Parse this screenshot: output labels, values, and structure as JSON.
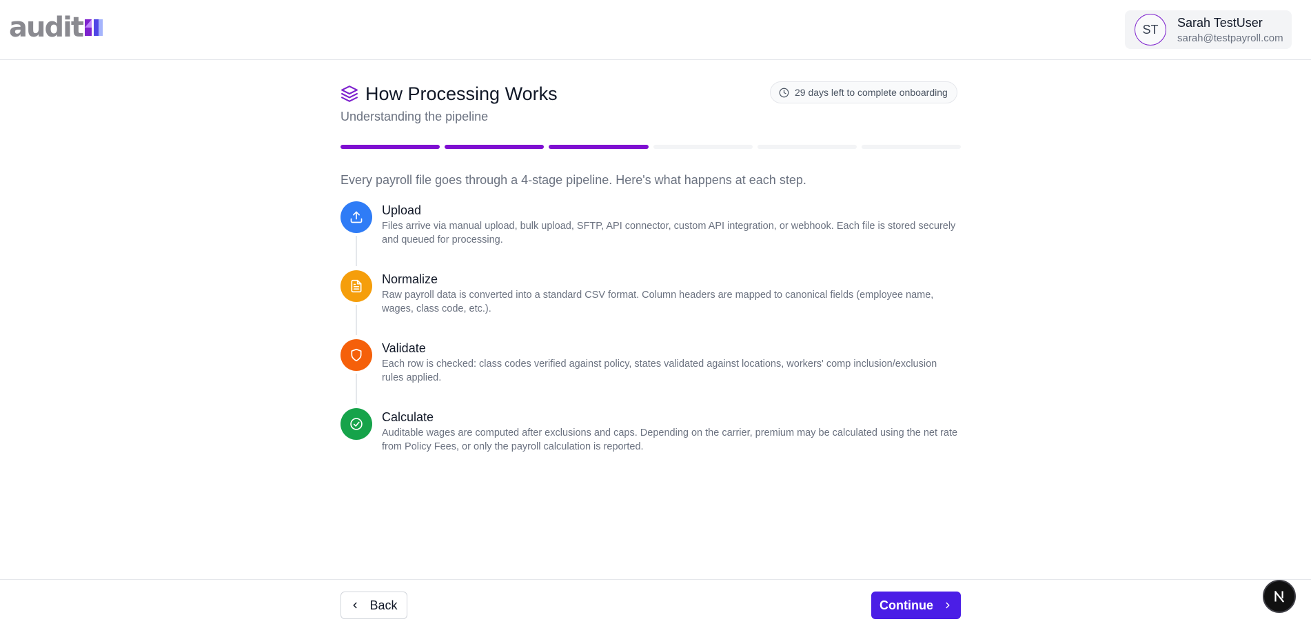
{
  "header": {
    "logo_text": "audit",
    "user": {
      "initials": "ST",
      "name": "Sarah TestUser",
      "email": "sarah@testpayroll.com"
    }
  },
  "page": {
    "title": "How Processing Works",
    "subtitle": "Understanding the pipeline",
    "days_left_text": "29 days left to complete onboarding",
    "progress": {
      "completed_steps": 3,
      "total_steps": 6
    },
    "intro": "Every payroll file goes through a 4-stage pipeline. Here's what happens at each step.",
    "steps": [
      {
        "title": "Upload",
        "icon": "upload-icon",
        "color": "#2f7cf6",
        "description": "Files arrive via manual upload, bulk upload, SFTP, API connector, custom API integration, or webhook. Each file is stored securely and queued for processing."
      },
      {
        "title": "Normalize",
        "icon": "file-text-icon",
        "color": "#f59e0b",
        "description": "Raw payroll data is converted into a standard CSV format. Column headers are mapped to canonical fields (employee name, wages, class code, etc.)."
      },
      {
        "title": "Validate",
        "icon": "shield-icon",
        "color": "#f5600a",
        "description": "Each row is checked: class codes verified against policy, states validated against locations, workers' comp inclusion/exclusion rules applied."
      },
      {
        "title": "Calculate",
        "icon": "check-circle-icon",
        "color": "#16a34a",
        "description": "Auditable wages are computed after exclusions and caps. Depending on the carrier, premium may be calculated using the net rate from Policy Fees, or only the payroll calculation is reported."
      }
    ]
  },
  "footer": {
    "back_label": "Back",
    "continue_label": "Continue"
  },
  "colors": {
    "accent_purple": "#7e0fd1",
    "continue_button": "#4b1ee6"
  }
}
